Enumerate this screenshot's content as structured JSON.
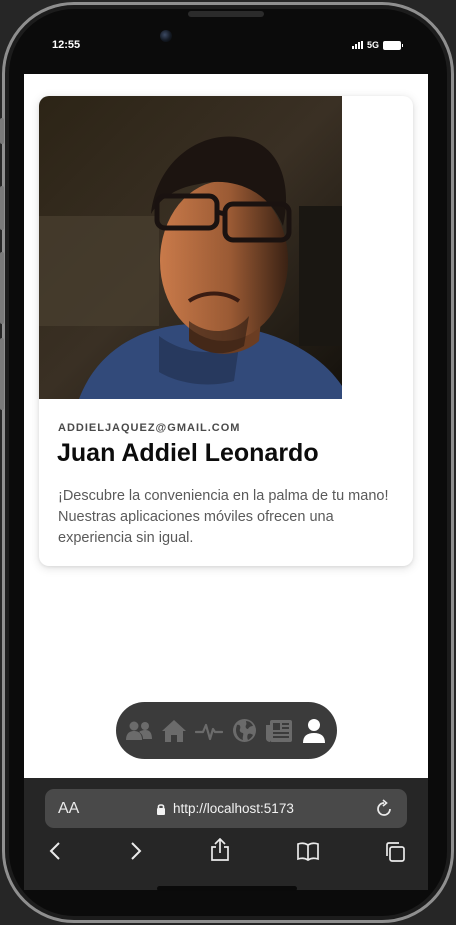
{
  "status": {
    "time": "12:55",
    "network": "5G"
  },
  "profile": {
    "photo_alt": "profile photo",
    "email": "ADDIELJAQUEZ@GMAIL.COM",
    "name": "Juan Addiel Leonardo",
    "description": "¡Descubre la conveniencia en la palma de tu mano! Nuestras aplicaciones móviles ofrecen una experiencia sin igual."
  },
  "tabbar": {
    "items": [
      {
        "icon": "users-icon",
        "active": false
      },
      {
        "icon": "home-icon",
        "active": false
      },
      {
        "icon": "heartbeat-icon",
        "active": false
      },
      {
        "icon": "globe-icon",
        "active": false
      },
      {
        "icon": "newspaper-icon",
        "active": false
      },
      {
        "icon": "user-icon",
        "active": true
      }
    ],
    "colors": {
      "background": "#3b3b3b",
      "inactive": "#6b6b6b",
      "active": "#ffffff"
    }
  },
  "browser": {
    "text_size_label": "AA",
    "url": "http://localhost:5173"
  }
}
